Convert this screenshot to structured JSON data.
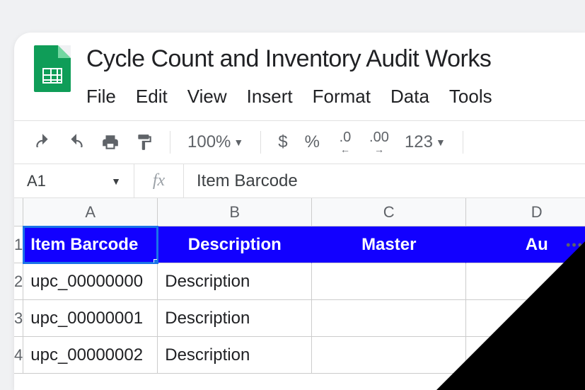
{
  "doc": {
    "title": "Cycle Count and Inventory Audit Works"
  },
  "menu": {
    "file": "File",
    "edit": "Edit",
    "view": "View",
    "insert": "Insert",
    "format": "Format",
    "data": "Data",
    "tools": "Tools"
  },
  "toolbar": {
    "zoom": "100%",
    "currency": "$",
    "percent": "%",
    "dec_dec": ".0",
    "dec_inc": ".00",
    "numfmt": "123"
  },
  "namebox": {
    "ref": "A1",
    "formula": "Item Barcode"
  },
  "columns": [
    "A",
    "B",
    "C",
    "D"
  ],
  "headers": {
    "a": "Item Barcode",
    "b": "Description",
    "c": "Master",
    "d": "Au"
  },
  "rows": [
    {
      "n": "1"
    },
    {
      "n": "2",
      "a": "upc_00000000",
      "b": "Description"
    },
    {
      "n": "3",
      "a": "upc_00000001",
      "b": "Description"
    },
    {
      "n": "4",
      "a": "upc_00000002",
      "b": "Description"
    }
  ]
}
